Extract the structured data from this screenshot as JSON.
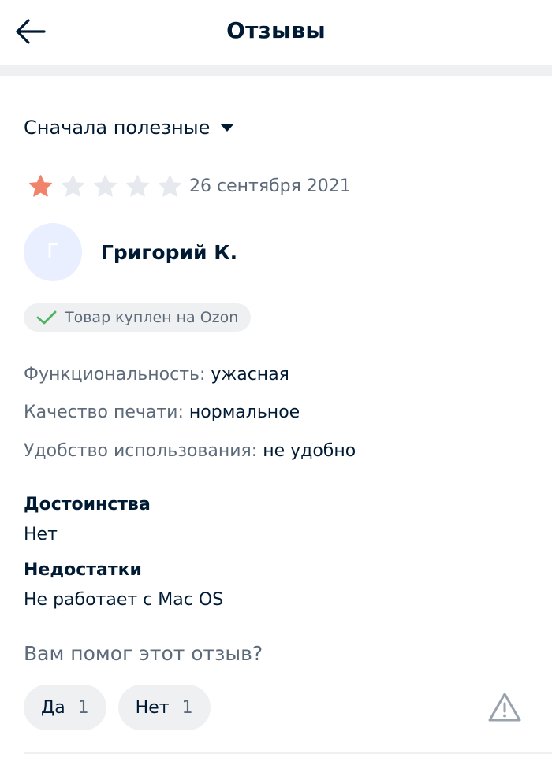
{
  "header": {
    "title": "Отзывы",
    "back_icon": "arrow-left-icon"
  },
  "sort": {
    "label": "Сначала полезные",
    "icon": "caret-down-icon"
  },
  "review": {
    "rating": 1,
    "rating_max": 5,
    "date": "26 сентября 2021",
    "author": {
      "initial": "Г",
      "name": "Григорий К."
    },
    "badge": {
      "text": "Товар куплен на Ozon",
      "icon": "check-icon"
    },
    "properties": [
      {
        "key": "Функциональность:",
        "value": "ужасная"
      },
      {
        "key": "Качество печати:",
        "value": "нормальное"
      },
      {
        "key": "Удобство использования:",
        "value": "не удобно"
      }
    ],
    "pros": {
      "title": "Достоинства",
      "text": "Нет"
    },
    "cons": {
      "title": "Недостатки",
      "text": "Не работает с Mac OS"
    },
    "helpful": {
      "question": "Вам помог этот отзыв?",
      "yes": {
        "label": "Да",
        "count": "1"
      },
      "no": {
        "label": "Нет",
        "count": "1"
      }
    }
  },
  "colors": {
    "text_primary": "#001a34",
    "text_secondary": "#5d6a79",
    "star_active": "#f2836b",
    "star_inactive": "#e6e9ee",
    "check": "#4fb45f",
    "chip_bg": "#eef0f2"
  }
}
